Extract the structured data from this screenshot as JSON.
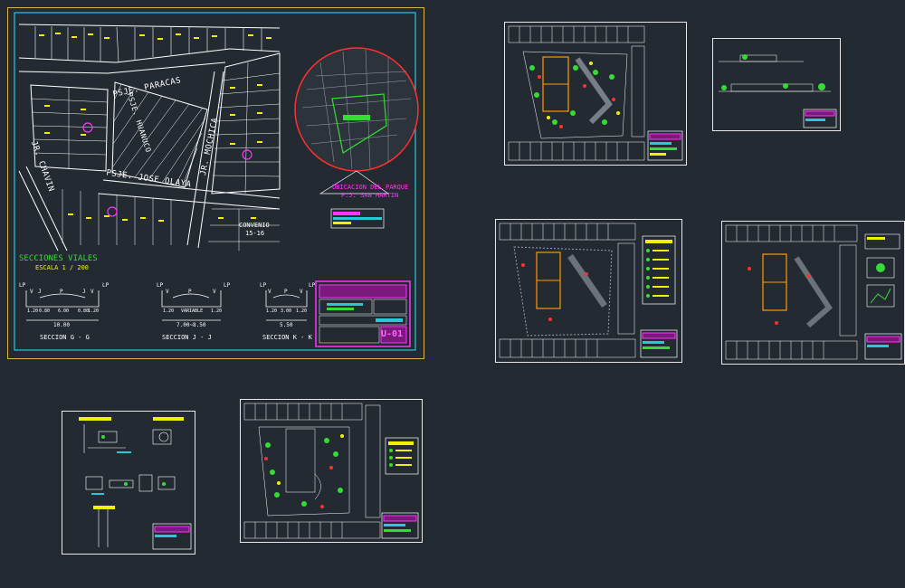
{
  "colors": {
    "background": "#232a32",
    "frame_outer": "#d9b24a",
    "frame_inner": "#28c8d8",
    "lines": "#ffffff",
    "lots": "#f0f000",
    "accent_green": "#33dd33",
    "accent_magenta": "#ff33ff",
    "accent_red": "#ff3030",
    "accent_cyan": "#28c8d8"
  },
  "main_sheet": {
    "streets": {
      "psje_paracas": "PSJE. PARACAS",
      "psje_jose_olaya": "PSJE. JOSE OLAYA",
      "jr_mochica": "JR. MOCHICA",
      "jr_chavin": "JR. CHAVIN",
      "psje_huanuco": "PSJE. HUANUCO"
    },
    "lot_label_convenio": "CONVENIO",
    "lot_label_convenio_num": "15-16",
    "location_title_1": "UBICACION DEL PARQUE",
    "location_title_2": "P.J. SAN MARTIN",
    "sections_title": "SECCIONES VIALES",
    "sections_scale": "ESCALA 1 / 200",
    "sections": [
      {
        "name": "SECCION G - G",
        "total": "10.00",
        "parts": [
          "1.20",
          "0.80",
          "6.00",
          "0.80",
          "1.20"
        ],
        "letters": [
          "LP",
          "V",
          "J",
          "P",
          "J",
          "V",
          "LP"
        ]
      },
      {
        "name": "SECCION J - J",
        "total": "7.00~8.50",
        "parts": [
          "1.20",
          "VARIABLE",
          "1.20"
        ],
        "letters": [
          "LP",
          "V",
          "P",
          "V",
          "LP"
        ]
      },
      {
        "name": "SECCION K - K",
        "total": "5.50",
        "parts": [
          "1.20",
          "3.00",
          "1.20"
        ],
        "letters": [
          "LP",
          "V",
          "P",
          "V",
          "LP"
        ]
      }
    ],
    "sheet_code": "U-01"
  }
}
